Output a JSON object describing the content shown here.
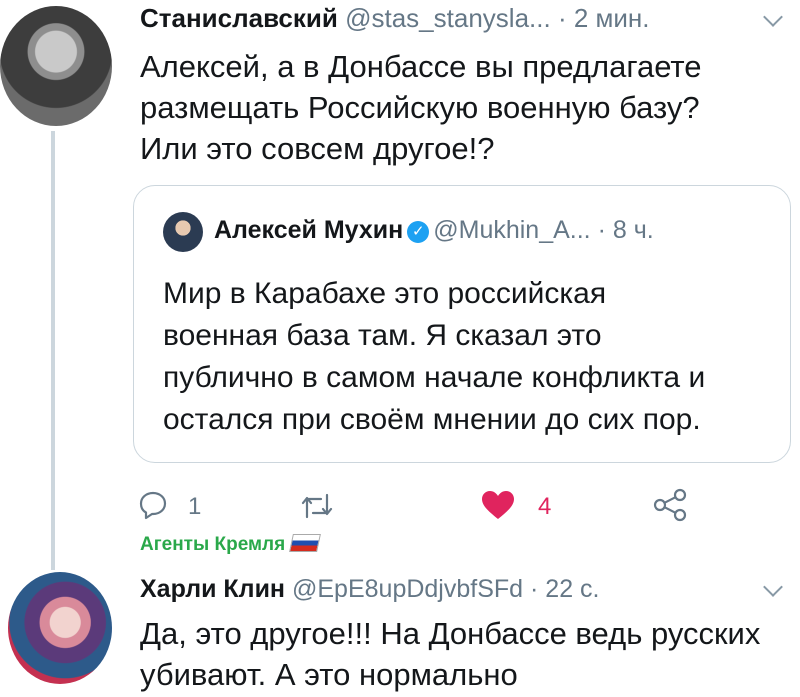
{
  "tweet1": {
    "name": "Станиславский",
    "handle": "@stas_stanysla...",
    "time": "· 2 мин.",
    "text_lines": [
      "Алексей, а в Донбассе вы предлагаете",
      "размещать Российскую военную базу?",
      "Или это совсем другое!?"
    ]
  },
  "quoted": {
    "name": "Алексей Мухин",
    "handle": "@Mukhin_A...",
    "time": "· 8 ч.",
    "text_lines": [
      "Мир в Карабахе это российская",
      "военная база там. Я сказал это",
      "публично в самом начале конфликта и",
      "остался при своём мнении до сих пор."
    ]
  },
  "actions": {
    "reply_count": "1",
    "retweet_count": "",
    "like_count": "4"
  },
  "overlay": {
    "agents_text": "Агенты Кремля"
  },
  "tweet2": {
    "name": "Харли Клин",
    "handle": "@EpE8upDdjvbfSFd",
    "time": "· 22 с.",
    "text_lines": [
      "Да, это другое!!! На Донбассе ведь русских",
      "убивают. А это нормально"
    ]
  },
  "colors": {
    "accent": "#1da1f2",
    "like": "#e0245e",
    "agents": "#2aa84a",
    "muted": "#657786"
  }
}
